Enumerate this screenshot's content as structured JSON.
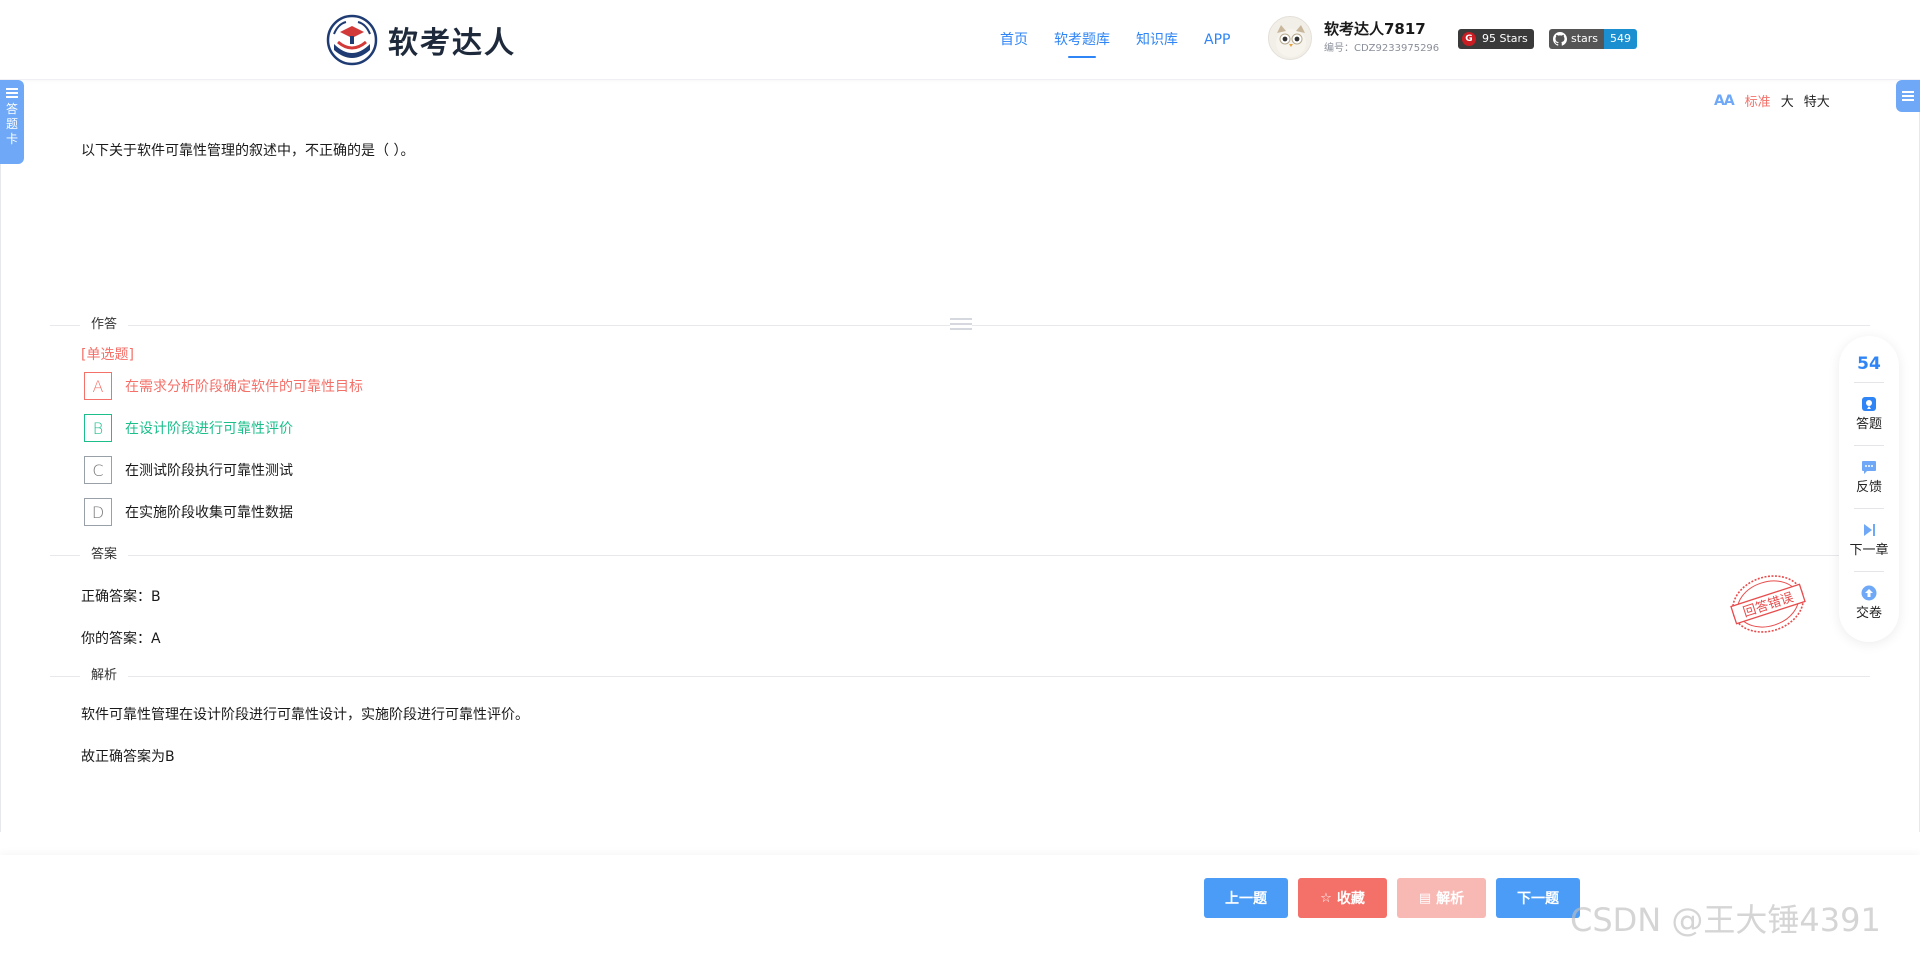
{
  "header": {
    "brand_name": "软考达人",
    "nav": [
      "首页",
      "软考题库",
      "知识库",
      "APP"
    ],
    "nav_active": "软考题库",
    "user_name": "软考达人7817",
    "user_id": "编号：CDZ9233975296",
    "badge_gitee": "95 Stars",
    "badge_github_label": "stars",
    "badge_github_count": "549"
  },
  "left_tab": {
    "label": "答题卡"
  },
  "font_toggle": {
    "options": [
      "标准",
      "大",
      "特大"
    ],
    "active": "标准"
  },
  "question": {
    "text": "以下关于软件可靠性管理的叙述中，不正确的是（ ）。",
    "type": "[单选题]",
    "options": [
      {
        "letter": "A",
        "text": "在需求分析阶段确定软件的可靠性目标",
        "state": "wrong"
      },
      {
        "letter": "B",
        "text": "在设计阶段进行可靠性评价",
        "state": "right"
      },
      {
        "letter": "C",
        "text": "在测试阶段执行可靠性测试",
        "state": "normal"
      },
      {
        "letter": "D",
        "text": "在实施阶段收集可靠性数据",
        "state": "normal"
      }
    ]
  },
  "sections": {
    "answer_area": "作答",
    "answer": "答案",
    "analysis": "解析"
  },
  "answer": {
    "correct": "正确答案：B",
    "yours": "你的答案：A"
  },
  "analysis": {
    "line1": "软件可靠性管理在设计阶段进行可靠性设计，实施阶段进行可靠性评价。",
    "line2": "故正确答案为B"
  },
  "stamp": {
    "text": "回答错误",
    "color": "#e74c4c"
  },
  "side_tools": {
    "count": "54",
    "items": [
      "答题",
      "反馈",
      "下一章",
      "交卷"
    ]
  },
  "buttons": {
    "prev": "上一题",
    "favorite": "收藏",
    "analysis": "解析",
    "next": "下一题"
  },
  "watermark": "CSDN @王大锤4391",
  "colors": {
    "primary": "#2f85f5",
    "wrong": "#f4716a",
    "right": "#1cbf8c"
  }
}
